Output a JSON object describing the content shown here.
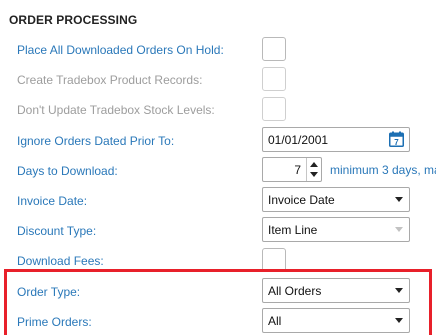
{
  "section": {
    "title": "ORDER PROCESSING"
  },
  "fields": {
    "place_on_hold": {
      "label": "Place All Downloaded Orders On Hold:",
      "checked": false
    },
    "create_tradebox_records": {
      "label": "Create Tradebox Product Records:",
      "checked": false,
      "disabled": true
    },
    "dont_update_stock": {
      "label": "Don't Update Tradebox Stock Levels:",
      "checked": false,
      "disabled": true
    },
    "ignore_orders_prior": {
      "label": "Ignore Orders Dated Prior To:",
      "value": "01/01/2001",
      "icon": "calendar-icon",
      "icon_day": "7"
    },
    "days_to_download": {
      "label": "Days to Download:",
      "value": "7",
      "hint": "minimum 3 days, ma"
    },
    "invoice_date": {
      "label": "Invoice Date:",
      "value": "Invoice Date"
    },
    "discount_type": {
      "label": "Discount Type:",
      "value": "Item Line",
      "disabled": true
    },
    "download_fees": {
      "label": "Download Fees:",
      "checked": false
    },
    "order_type": {
      "label": "Order Type:",
      "value": "All Orders"
    },
    "prime_orders": {
      "label": "Prime Orders:",
      "value": "All"
    }
  },
  "colors": {
    "label": "#2a78b9",
    "disabled_label": "#9d9d9d",
    "highlight": "#e8202a",
    "calendar_accent": "#1c6fb3"
  }
}
